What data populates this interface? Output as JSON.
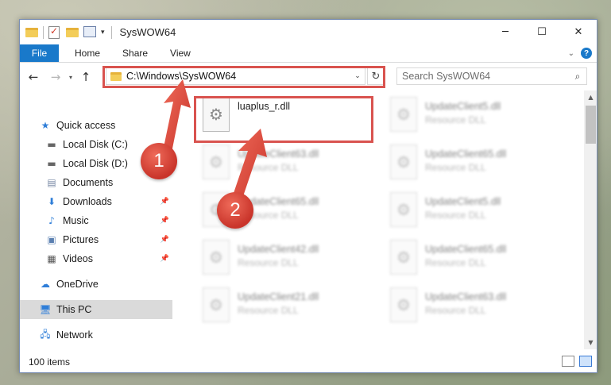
{
  "window": {
    "title": "SysWOW64",
    "controls": {
      "minimize": "─",
      "maximize": "☐",
      "close": "✕"
    }
  },
  "ribbon": {
    "tabs": [
      "File",
      "Home",
      "Share",
      "View"
    ],
    "help_label": "?"
  },
  "address_bar": {
    "path": "C:\\Windows\\SysWOW64"
  },
  "search": {
    "placeholder": "Search SysWOW64"
  },
  "nav_pane": {
    "items": [
      {
        "label": "Quick access",
        "icon": "star-icon",
        "pinned": false
      },
      {
        "label": "Local Disk (C:)",
        "icon": "drive-icon",
        "pinned": false
      },
      {
        "label": "Local Disk (D:)",
        "icon": "drive-icon",
        "pinned": false
      },
      {
        "label": "Documents",
        "icon": "documents-icon",
        "pinned": false
      },
      {
        "label": "Downloads",
        "icon": "downloads-icon",
        "pinned": true
      },
      {
        "label": "Music",
        "icon": "music-icon",
        "pinned": true
      },
      {
        "label": "Pictures",
        "icon": "pictures-icon",
        "pinned": true
      },
      {
        "label": "Videos",
        "icon": "videos-icon",
        "pinned": true
      },
      {
        "label": "OneDrive",
        "icon": "cloud-icon",
        "pinned": false
      },
      {
        "label": "This PC",
        "icon": "computer-icon",
        "pinned": false,
        "selected": true
      },
      {
        "label": "Network",
        "icon": "network-icon",
        "pinned": false
      }
    ]
  },
  "files": [
    {
      "name": "luaplus_r.dll",
      "type": ""
    },
    {
      "name": "UpdateClient5.dll",
      "type": "Resource DLL"
    },
    {
      "name": "UpdateClient63.dll",
      "type": "Resource DLL"
    },
    {
      "name": "UpdateClient65.dll",
      "type": "Resource DLL"
    },
    {
      "name": "UpdateClient65.dll",
      "type": "Resource DLL"
    },
    {
      "name": "UpdateClient5.dll",
      "type": "Resource DLL"
    },
    {
      "name": "UpdateClient42.dll",
      "type": "Resource DLL"
    },
    {
      "name": "UpdateClient65.dll",
      "type": "Resource DLL"
    },
    {
      "name": "UpdateClient21.dll",
      "type": "Resource DLL"
    },
    {
      "name": "UpdateClient63.dll",
      "type": "Resource DLL"
    }
  ],
  "status_bar": {
    "item_count": "100 items"
  },
  "annotations": {
    "step1": "1",
    "step2": "2",
    "highlight_color": "#d9534f"
  }
}
